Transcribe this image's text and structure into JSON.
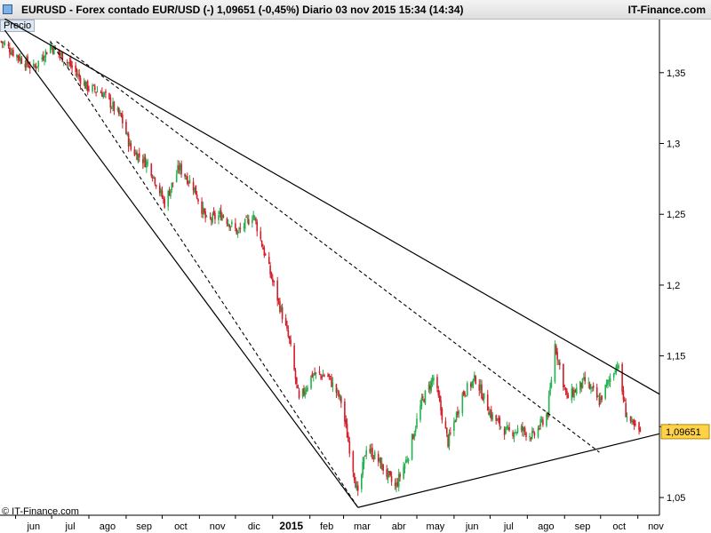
{
  "header": {
    "title": "EURUSD - Forex contado EUR/USD (-)    1,09651 (-0,45%)    Diario  03 nov 2015 15:34 (14:34)",
    "brand": "IT-Finance.com"
  },
  "price_badge": "Precio",
  "last_price_label": "1,09651",
  "copyright": "© IT-Finance.com",
  "colors": {
    "up": "#22b14c",
    "down": "#d21e2a",
    "trend": "#000000",
    "label_bg": "#ffd24a"
  },
  "chart_data": {
    "type": "candlestick",
    "title": "",
    "xlabel": "",
    "ylabel": "",
    "x_ticks": [
      "jun",
      "jul",
      "ago",
      "sep",
      "oct",
      "nov",
      "dic",
      "2015",
      "feb",
      "mar",
      "abr",
      "may",
      "jun",
      "jul",
      "ago",
      "sep",
      "oct",
      "nov"
    ],
    "y_ticks": [
      {
        "value": 1.35,
        "label": "1,35"
      },
      {
        "value": 1.3,
        "label": "1,3"
      },
      {
        "value": 1.25,
        "label": "1,25"
      },
      {
        "value": 1.2,
        "label": "1,2"
      },
      {
        "value": 1.15,
        "label": "1,15"
      },
      {
        "value": 1.1,
        "label": "1,1"
      },
      {
        "value": 1.05,
        "label": "1,05"
      }
    ],
    "ylim": [
      1.0375,
      1.3875
    ],
    "x_range": [
      "2014-05-19",
      "2015-11-19"
    ],
    "last_value": 1.09651,
    "series_path": [
      [
        "2014-05-20",
        1.372
      ],
      [
        "2014-06-05",
        1.36
      ],
      [
        "2014-06-16",
        1.353
      ],
      [
        "2014-06-30",
        1.369
      ],
      [
        "2014-07-15",
        1.357
      ],
      [
        "2014-07-30",
        1.34
      ],
      [
        "2014-08-12",
        1.336
      ],
      [
        "2014-08-28",
        1.318
      ],
      [
        "2014-09-05",
        1.296
      ],
      [
        "2014-09-20",
        1.285
      ],
      [
        "2014-10-03",
        1.258
      ],
      [
        "2014-10-15",
        1.283
      ],
      [
        "2014-10-27",
        1.27
      ],
      [
        "2014-11-07",
        1.245
      ],
      [
        "2014-11-20",
        1.25
      ],
      [
        "2014-12-03",
        1.237
      ],
      [
        "2014-12-16",
        1.25
      ],
      [
        "2014-12-26",
        1.22
      ],
      [
        "2015-01-08",
        1.182
      ],
      [
        "2015-01-15",
        1.16
      ],
      [
        "2015-01-23",
        1.118
      ],
      [
        "2015-02-03",
        1.137
      ],
      [
        "2015-02-16",
        1.136
      ],
      [
        "2015-02-27",
        1.118
      ],
      [
        "2015-03-06",
        1.085
      ],
      [
        "2015-03-13",
        1.051
      ],
      [
        "2015-03-20",
        1.086
      ],
      [
        "2015-03-30",
        1.076
      ],
      [
        "2015-04-13",
        1.057
      ],
      [
        "2015-04-23",
        1.078
      ],
      [
        "2015-05-05",
        1.117
      ],
      [
        "2015-05-15",
        1.135
      ],
      [
        "2015-05-27",
        1.089
      ],
      [
        "2015-06-08",
        1.123
      ],
      [
        "2015-06-19",
        1.134
      ],
      [
        "2015-07-02",
        1.108
      ],
      [
        "2015-07-15",
        1.096
      ],
      [
        "2015-07-27",
        1.098
      ],
      [
        "2015-08-06",
        1.093
      ],
      [
        "2015-08-18",
        1.11
      ],
      [
        "2015-08-24",
        1.158
      ],
      [
        "2015-09-03",
        1.12
      ],
      [
        "2015-09-18",
        1.132
      ],
      [
        "2015-09-30",
        1.118
      ],
      [
        "2015-10-15",
        1.145
      ],
      [
        "2015-10-22",
        1.11
      ],
      [
        "2015-10-28",
        1.1
      ],
      [
        "2015-11-03",
        1.0965
      ]
    ],
    "trendlines": [
      {
        "style": "solid",
        "from": [
          "2014-05-23",
          1.38
        ],
        "to": [
          "2015-03-13",
          1.043
        ]
      },
      {
        "style": "solid",
        "from": [
          "2014-05-23",
          1.388
        ],
        "to": [
          "2015-11-19",
          1.123
        ]
      },
      {
        "style": "dashed",
        "from": [
          "2014-06-30",
          1.372
        ],
        "to": [
          "2015-03-13",
          1.043
        ]
      },
      {
        "style": "dashed",
        "from": [
          "2014-07-05",
          1.372
        ],
        "to": [
          "2015-09-30",
          1.082
        ]
      },
      {
        "style": "solid",
        "from": [
          "2015-03-13",
          1.043
        ],
        "to": [
          "2015-11-19",
          1.095
        ]
      }
    ]
  }
}
